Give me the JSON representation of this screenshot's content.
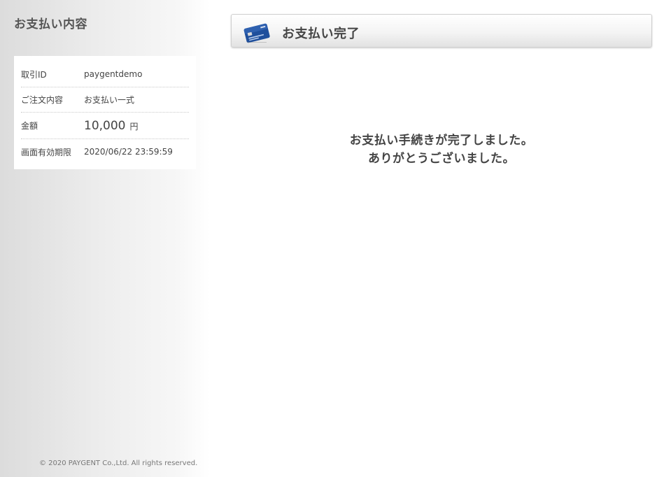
{
  "sidebar": {
    "title": "お支払い内容",
    "rows": [
      {
        "label": "取引ID",
        "value": "paygentdemo"
      },
      {
        "label": "ご注文内容",
        "value": "お支払い一式"
      },
      {
        "label": "金額",
        "value": "10,000",
        "unit": "円"
      },
      {
        "label": "画面有効期限",
        "value": "2020/06/22 23:59:59"
      }
    ]
  },
  "header": {
    "icon": "credit-card-icon",
    "title": "お支払い完了"
  },
  "message": {
    "line1": "お支払い手続きが完了しました。",
    "line2": "ありがとうございました。"
  },
  "footer": {
    "copyright": "© 2020 PAYGENT Co.,Ltd. All rights reserved."
  },
  "colors": {
    "card_blue": "#1f4f9c",
    "text": "#444444"
  }
}
